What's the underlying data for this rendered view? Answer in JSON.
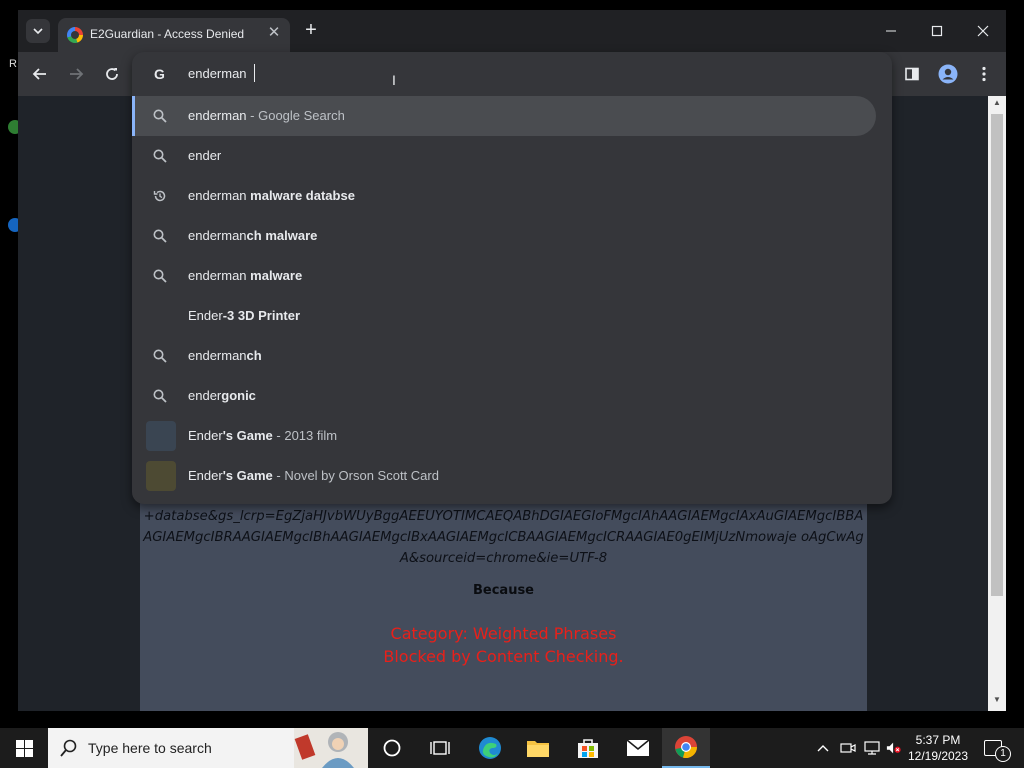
{
  "window": {
    "tab_title": "E2Guardian - Access Denied"
  },
  "omnibox": {
    "input": "enderman",
    "suggestions": [
      {
        "pre": "enderman",
        "bold": "",
        "dim": " - Google Search",
        "icon": "search-icon"
      },
      {
        "pre": "ender",
        "bold": "",
        "dim": "",
        "icon": "search-icon"
      },
      {
        "pre": "enderman ",
        "bold": "malware databse",
        "dim": "",
        "icon": "history-icon"
      },
      {
        "pre": "enderman",
        "bold": "ch malware",
        "dim": "",
        "icon": "search-icon"
      },
      {
        "pre": "enderman ",
        "bold": "malware",
        "dim": "",
        "icon": "search-icon"
      },
      {
        "pre": "Ender",
        "bold": "-3 3D Printer",
        "dim": "",
        "icon": "none"
      },
      {
        "pre": "enderman",
        "bold": "ch",
        "dim": "",
        "icon": "search-icon"
      },
      {
        "pre": "ender",
        "bold": "gonic",
        "dim": "",
        "icon": "search-icon"
      },
      {
        "pre": "Ender",
        "bold": "'s Game",
        "dim": " - 2013 film",
        "icon": "movie-thumbnail"
      },
      {
        "pre": "Ender",
        "bold": "'s Game",
        "dim": " - Novel by Orson Scott Card",
        "icon": "book-thumbnail"
      }
    ]
  },
  "page": {
    "blocked_url_fragment": "+databse&gs_lcrp=EgZjaHJvbWUyBggAEEUYOTIMCAEQABhDGIAEGIoFMgcIAhAAGIAEMgcIAxAuGIAEMgcIBBAAGIAEMgcIBRAAGIAEMgcIBhAAGIAEMgcIBxAAGIAEMgcICBAAGIAEMgcICRAAGIAE0gEIMjUzNmowaje oAgCwAgA&sourceid=chrome&ie=UTF-8",
    "because_label": "Because",
    "reason_category": "Category: Weighted Phrases",
    "reason_detail": "Blocked by Content Checking."
  },
  "taskbar": {
    "search_placeholder": "Type here to search",
    "clock_time": "5:37 PM",
    "clock_date": "12/19/2023",
    "notification_count": "1"
  },
  "colors": {
    "reason_text": "#e8201a",
    "selected_bar": "#8ab4f8",
    "page_panel": "#444c5c"
  }
}
